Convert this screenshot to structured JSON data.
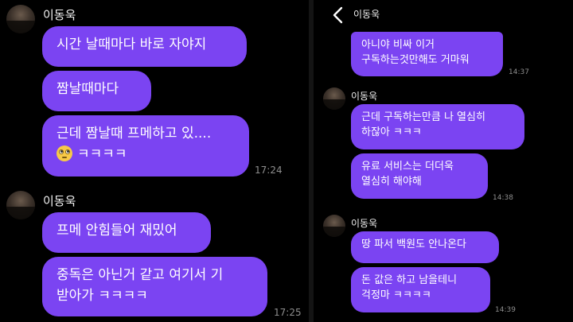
{
  "left": {
    "group1": {
      "sender": "이동욱",
      "messages": [
        "시간 날때마다 바로 자야지",
        "짬날때마다"
      ],
      "third_lines": [
        "근데 짬날때 프메하고 있....",
        "ㅋㅋㅋㅋ"
      ],
      "emoji": "rolling-eyes-emoji",
      "time": "17:24"
    },
    "group2": {
      "sender": "이동욱",
      "messages": [
        "프메 안힘들어 재밌어"
      ],
      "second_lines": [
        "중독은 아닌거 같고 여기서 기",
        "받아가 ㅋㅋㅋㅋ"
      ],
      "time": "17:25"
    }
  },
  "right": {
    "header": {
      "title": "이동욱",
      "back_icon": "chevron-left-icon"
    },
    "top_bubble_lines": [
      "아니야 비싸 이거",
      "구독하는것만해도 거마워"
    ],
    "top_time": "14:37",
    "group1": {
      "sender": "이동욱",
      "bubble1_lines": [
        "근데 구독하는만큼 나 열심히",
        "하잖아 ㅋㅋㅋ"
      ],
      "bubble2_lines": [
        "유료 서비스는 더더욱",
        "열심히 해야해"
      ],
      "time": "14:38"
    },
    "group2": {
      "sender": "이동욱",
      "bubble1_lines": [
        "땅 파서 백원도 안나온다"
      ],
      "bubble2_lines": [
        "돈 값은 하고 남을테니",
        "걱정마 ㅋㅋㅋㅋ"
      ],
      "time": "14:39"
    }
  },
  "colors": {
    "bubble": "#7b44f2",
    "background": "#000000",
    "time": "#8e8e8e"
  }
}
